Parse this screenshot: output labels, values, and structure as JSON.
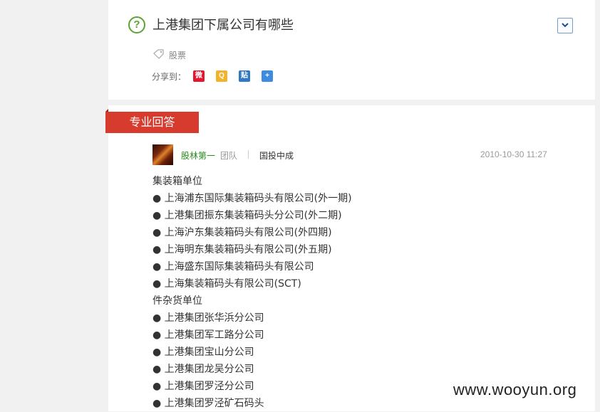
{
  "question": {
    "title": "上港集团下属公司有哪些",
    "tag": "股票",
    "share_label": "分享到：",
    "share_buttons": [
      {
        "name": "weibo",
        "glyph": "微",
        "color": "#e6162d"
      },
      {
        "name": "qzone",
        "glyph": "Q",
        "color": "#f2b32a"
      },
      {
        "name": "tieba",
        "glyph": "贴",
        "color": "#2f79c4"
      },
      {
        "name": "more",
        "glyph": "+",
        "color": "#3e8ce2"
      }
    ]
  },
  "answer": {
    "badge": "专业回答",
    "author": "股林第一",
    "role": "团队",
    "org": "国投中成",
    "timestamp": "2010-10-30 11:27",
    "lines": [
      "集装箱单位",
      "● 上海浦东国际集装箱码头有限公司(外一期)",
      "● 上港集团振东集装箱码头分公司(外二期)",
      "● 上海沪东集装箱码头有限公司(外四期)",
      "● 上海明东集装箱码头有限公司(外五期)",
      "● 上海盛东国际集装箱码头有限公司",
      "● 上海集装箱码头有限公司(SCT)",
      "件杂货单位",
      "● 上港集团张华浜分公司",
      "● 上港集团军工路分公司",
      "● 上港集团宝山分公司",
      "● 上港集团龙吴分公司",
      "● 上港集团罗泾分公司",
      "● 上港集团罗泾矿石码头"
    ]
  },
  "watermark": "www.wooyun.org",
  "colors": {
    "badge": "#d63b2e",
    "author": "#2a8c1e",
    "question_icon": "#5aa532"
  }
}
